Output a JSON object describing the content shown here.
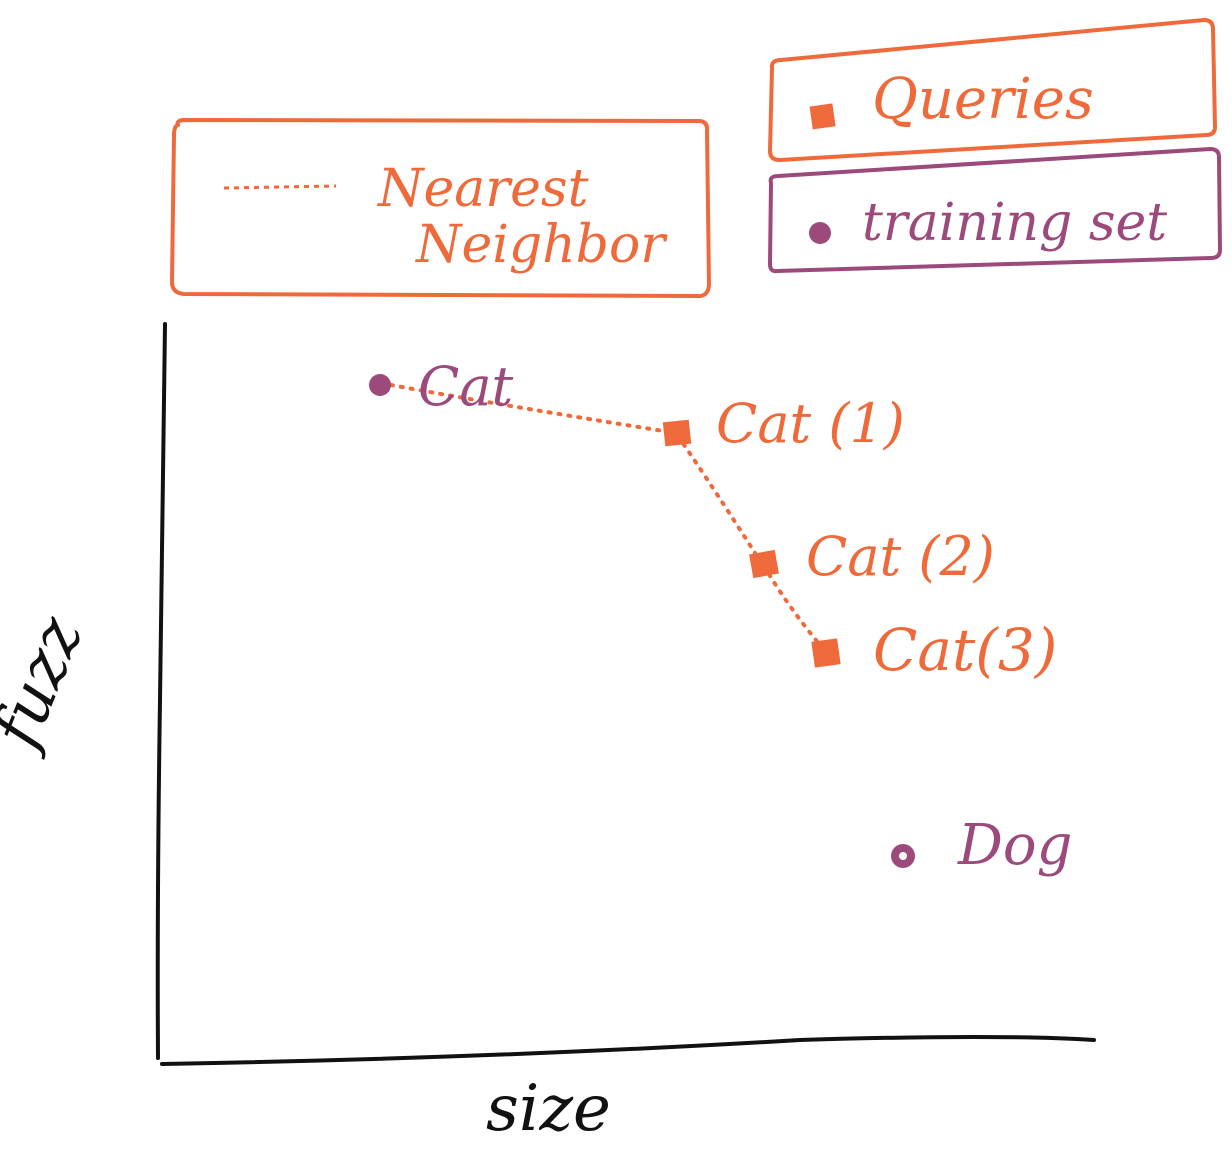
{
  "colors": {
    "orange": "#EF6A3A",
    "purple": "#9C4A7C",
    "ink": "#111111",
    "background": "#FFFFFF"
  },
  "legend": {
    "nearest_neighbor": {
      "line1": "Nearest",
      "line2": "Neighbor",
      "symbol": "dotted-line"
    },
    "queries": {
      "label": "Queries",
      "symbol": "square-marker"
    },
    "training_set": {
      "label": "training set",
      "symbol": "circle-marker"
    }
  },
  "axes": {
    "x_label": "size",
    "y_label": "fuzz"
  },
  "points": {
    "training": [
      {
        "label": "Cat"
      },
      {
        "label": "Dog"
      }
    ],
    "queries": [
      {
        "label": "Cat (1)"
      },
      {
        "label": "Cat (2)"
      },
      {
        "label": "Cat(3)"
      }
    ]
  }
}
